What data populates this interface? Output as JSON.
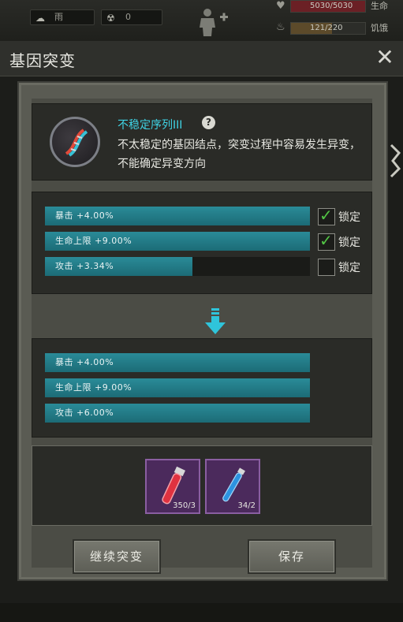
{
  "status": {
    "weather": "雨",
    "radiation": "0",
    "health": {
      "value": "5030/5030",
      "label": "生命",
      "fraction": 1.0,
      "color": "#b3262a"
    },
    "hunger": {
      "value": "121/220",
      "label": "饥饿",
      "fraction": 0.55,
      "color": "#c98a23"
    }
  },
  "dialog": {
    "title": "基因突变",
    "close": "✕"
  },
  "gene": {
    "name": "不稳定序列III",
    "help": "?",
    "description": "不太稳定的基因结点，突变过程中容易发生异变，不能确定异变方向",
    "icon": "dna-icon"
  },
  "current_attributes": [
    {
      "label": "暴击 +4.00%",
      "fill": 1.0,
      "locked": true,
      "lock_label": "锁定"
    },
    {
      "label": "生命上限 +9.00%",
      "fill": 1.0,
      "locked": true,
      "lock_label": "锁定"
    },
    {
      "label": "攻击 +3.34%",
      "fill": 0.556,
      "locked": false,
      "lock_label": "锁定"
    }
  ],
  "new_attributes": [
    {
      "label": "暴击 +4.00%",
      "fill": 1.0
    },
    {
      "label": "生命上限 +9.00%",
      "fill": 1.0
    },
    {
      "label": "攻击 +6.00%",
      "fill": 1.0
    }
  ],
  "materials": [
    {
      "name": "red-serum-vial-icon",
      "count": "350/3"
    },
    {
      "name": "blue-serum-vial-icon",
      "count": "34/2"
    }
  ],
  "buttons": {
    "continue": "继续突变",
    "save": "保存"
  },
  "colors": {
    "accent_cyan": "#3fd3e4",
    "bar_fill": "#2a8b98",
    "check_green": "#52c545",
    "slot_purple": "#4b2a5c"
  }
}
